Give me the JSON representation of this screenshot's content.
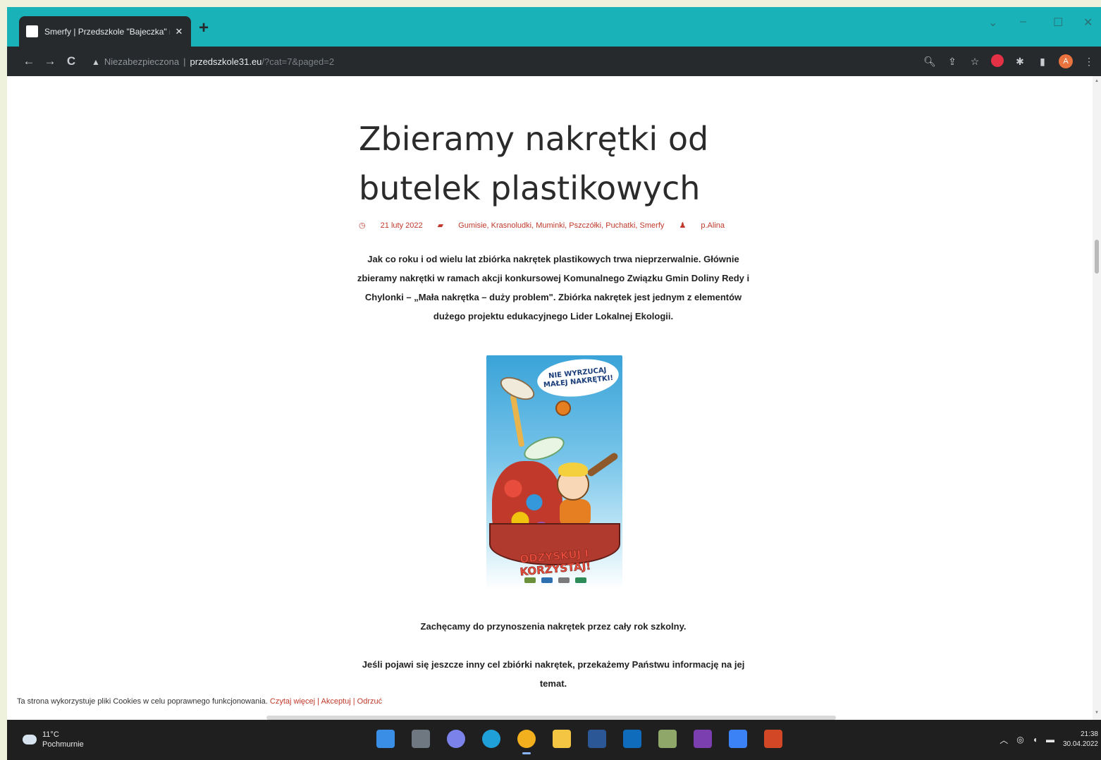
{
  "browser": {
    "tab_title": "Smerfy | Przedszkole \"Bajeczka\" n",
    "tab_close": "✕",
    "new_tab": "+",
    "window_controls": [
      "⌄",
      "–",
      "☐",
      "✕"
    ],
    "nav": {
      "back": "←",
      "forward": "→",
      "reload": "C"
    },
    "address": {
      "security_label": "Niezabezpieczona",
      "host": "przedszkole31.eu",
      "path": "/?cat=7&paged=2"
    },
    "toolbar_icons": [
      "zoom-icon",
      "share-icon",
      "bookmark-star-icon",
      "adblock-extension-icon",
      "extensions-puzzle-icon",
      "side-panel-icon",
      "profile-avatar",
      "menu-icon"
    ],
    "profile_initial": "A"
  },
  "post": {
    "title": "Zbieramy nakrętki od butelek plastikowych",
    "date": "21 luty 2022",
    "categories": "Gumisie, Krasnoludki, Muminki, Pszczółki, Puchatki, Smerfy",
    "author": "p.Alina",
    "paragraph1": "Jak co roku i od wielu lat zbiórka nakrętek plastikowych trwa nieprzerwalnie. Głównie zbieramy nakrętki w ramach akcji konkursowej Komunalnego Związku Gmin Doliny Redy i Chylonki – „Mała nakrętka – duży problem\".  Zbiórka nakrętek jest jednym z elementów dużego projektu edukacyjnego Lider Lokalnej Ekologii.",
    "poster": {
      "bubble_line1": "NIE WYRZUCAJ",
      "bubble_line2": "MAŁEJ NAKRĘTKI!",
      "slogan": "ODZYSKUJ I KORZYSTAJ!"
    },
    "paragraph2": "Zachęcamy do przynoszenia nakrętek przez cały rok szkolny.",
    "paragraph3": "Jeśli pojawi się jeszcze inny cel zbiórki nakrętek, przekażemy Państwu informację na jej temat."
  },
  "cookie_bar": {
    "text": "Ta strona wykorzystuje pliki Cookies w celu poprawnego funkcjonowania.",
    "read_more": "Czytaj więcej",
    "accept": "Akceptuj",
    "reject": "Odrzuć",
    "separator": "|"
  },
  "taskbar": {
    "weather_temp": "11°C",
    "weather_desc": "Pochmurnie",
    "time": "21:38",
    "date": "30.04.2022",
    "apps": [
      {
        "name": "start-icon",
        "color": "#3a8ee6"
      },
      {
        "name": "task-view-icon",
        "color": "#6f7780"
      },
      {
        "name": "teams-chat-icon",
        "color": "#7b83eb"
      },
      {
        "name": "edge-icon",
        "color": "#1fa0d8"
      },
      {
        "name": "chrome-icon",
        "color": "#f2b01e"
      },
      {
        "name": "file-explorer-icon",
        "color": "#f4c542"
      },
      {
        "name": "word-icon",
        "color": "#2b5797"
      },
      {
        "name": "outlook-icon",
        "color": "#0f6cbd"
      },
      {
        "name": "calculator-icon",
        "color": "#8fa86a"
      },
      {
        "name": "onenote-icon",
        "color": "#7b3fb0"
      },
      {
        "name": "paint-icon",
        "color": "#3b82f6"
      },
      {
        "name": "powerpoint-icon",
        "color": "#d24726"
      }
    ]
  }
}
